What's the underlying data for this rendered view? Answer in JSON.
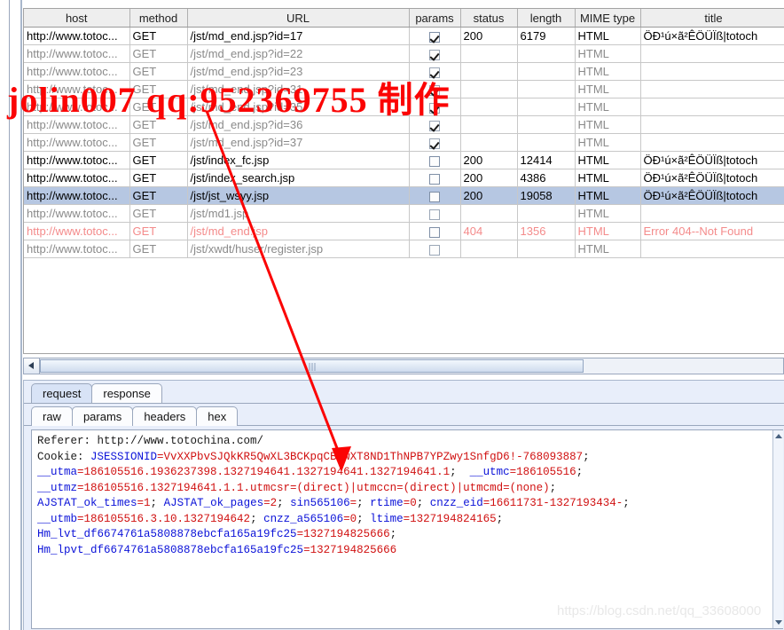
{
  "table": {
    "columns": [
      "host",
      "method",
      "URL",
      "params",
      "status",
      "length",
      "MIME type",
      "title"
    ],
    "rows": [
      {
        "host": "http://www.totoc...",
        "method": "GET",
        "url": "/jst/md_end.jsp?id=17",
        "params": true,
        "status": "200",
        "length": "6179",
        "mime": "HTML",
        "title": "ÖÐ¹ú×ã²ÊÖÜÏß|totoch",
        "style": "normal"
      },
      {
        "host": "http://www.totoc...",
        "method": "GET",
        "url": "/jst/md_end.jsp?id=22",
        "params": true,
        "status": "",
        "length": "",
        "mime": "HTML",
        "title": "",
        "style": "dim"
      },
      {
        "host": "http://www.totoc...",
        "method": "GET",
        "url": "/jst/md_end.jsp?id=23",
        "params": true,
        "status": "",
        "length": "",
        "mime": "HTML",
        "title": "",
        "style": "dim"
      },
      {
        "host": "http://www.totoc...",
        "method": "GET",
        "url": "/jst/md_end.jsp?id=31",
        "params": true,
        "status": "",
        "length": "",
        "mime": "HTML",
        "title": "",
        "style": "dim"
      },
      {
        "host": "http://www.totoc...",
        "method": "GET",
        "url": "/jst/md_end.jsp?id=35",
        "params": true,
        "status": "",
        "length": "",
        "mime": "HTML",
        "title": "",
        "style": "dim"
      },
      {
        "host": "http://www.totoc...",
        "method": "GET",
        "url": "/jst/md_end.jsp?id=36",
        "params": true,
        "status": "",
        "length": "",
        "mime": "HTML",
        "title": "",
        "style": "dim"
      },
      {
        "host": "http://www.totoc...",
        "method": "GET",
        "url": "/jst/md_end.jsp?id=37",
        "params": true,
        "status": "",
        "length": "",
        "mime": "HTML",
        "title": "",
        "style": "dim"
      },
      {
        "host": "http://www.totoc...",
        "method": "GET",
        "url": "/jst/index_fc.jsp",
        "params": false,
        "status": "200",
        "length": "12414",
        "mime": "HTML",
        "title": "ÖÐ¹ú×ã²ÊÖÜÏß|totoch",
        "style": "normal"
      },
      {
        "host": "http://www.totoc...",
        "method": "GET",
        "url": "/jst/index_search.jsp",
        "params": false,
        "status": "200",
        "length": "4386",
        "mime": "HTML",
        "title": "ÖÐ¹ú×ã²ÊÖÜÏß|totoch",
        "style": "normal"
      },
      {
        "host": "http://www.totoc...",
        "method": "GET",
        "url": "/jst/jst_wsyy.jsp",
        "params": false,
        "status": "200",
        "length": "19058",
        "mime": "HTML",
        "title": "ÖÐ¹ú×ã²ÊÖÜÏß|totoch",
        "style": "selected"
      },
      {
        "host": "http://www.totoc...",
        "method": "GET",
        "url": "/jst/md1.jsp",
        "params": false,
        "status": "",
        "length": "",
        "mime": "HTML",
        "title": "",
        "style": "dim"
      },
      {
        "host": "http://www.totoc...",
        "method": "GET",
        "url": "/jst/md_end.jsp",
        "params": false,
        "status": "404",
        "length": "1356",
        "mime": "HTML",
        "title": "Error 404--Not Found",
        "style": "error"
      },
      {
        "host": "http://www.totoc...",
        "method": "GET",
        "url": "/jst/xwdt/huser/register.jsp",
        "params": false,
        "status": "",
        "length": "",
        "mime": "HTML",
        "title": "",
        "style": "dim"
      }
    ]
  },
  "bottom": {
    "main_tabs": [
      {
        "label": "request",
        "active": true
      },
      {
        "label": "response",
        "active": false
      }
    ],
    "sub_tabs": [
      {
        "label": "raw",
        "active": true
      },
      {
        "label": "params",
        "active": false
      },
      {
        "label": "headers",
        "active": false
      },
      {
        "label": "hex",
        "active": false
      }
    ]
  },
  "request_body": {
    "lines": [
      [
        {
          "t": "Referer: http://www.totochina.com/",
          "c": "plain"
        }
      ],
      [
        {
          "t": "Cookie: ",
          "c": "plain"
        },
        {
          "t": "JSESSIONID",
          "c": "key"
        },
        {
          "t": "=VvXXPbvSJQkKR5QwXL3BCKpqCBJwXT8ND1ThNPB7YPZwy1SnfgD6!-768093887",
          "c": "val"
        },
        {
          "t": ";",
          "c": "plain"
        }
      ],
      [
        {
          "t": "__utma",
          "c": "key"
        },
        {
          "t": "=186105516.1936237398.1327194641.1327194641.1327194641.1",
          "c": "val"
        },
        {
          "t": ";  ",
          "c": "plain"
        },
        {
          "t": "__utmc",
          "c": "key"
        },
        {
          "t": "=186105516",
          "c": "val"
        },
        {
          "t": ";",
          "c": "plain"
        }
      ],
      [
        {
          "t": "__utmz",
          "c": "key"
        },
        {
          "t": "=186105516.1327194641.1.1.utmcsr=(direct)|utmccn=(direct)|utmcmd=(none)",
          "c": "val"
        },
        {
          "t": ";",
          "c": "plain"
        }
      ],
      [
        {
          "t": "AJSTAT_ok_times",
          "c": "key"
        },
        {
          "t": "=1",
          "c": "val"
        },
        {
          "t": "; ",
          "c": "plain"
        },
        {
          "t": "AJSTAT_ok_pages",
          "c": "key"
        },
        {
          "t": "=2",
          "c": "val"
        },
        {
          "t": "; ",
          "c": "plain"
        },
        {
          "t": "sin565106",
          "c": "key"
        },
        {
          "t": "=",
          "c": "val"
        },
        {
          "t": "; ",
          "c": "plain"
        },
        {
          "t": "rtime",
          "c": "key"
        },
        {
          "t": "=0",
          "c": "val"
        },
        {
          "t": "; ",
          "c": "plain"
        },
        {
          "t": "cnzz_eid",
          "c": "key"
        },
        {
          "t": "=16611731-1327193434-",
          "c": "val"
        },
        {
          "t": ";",
          "c": "plain"
        }
      ],
      [
        {
          "t": "__utmb",
          "c": "key"
        },
        {
          "t": "=186105516.3.10.1327194642",
          "c": "val"
        },
        {
          "t": "; ",
          "c": "plain"
        },
        {
          "t": "cnzz_a565106",
          "c": "key"
        },
        {
          "t": "=0",
          "c": "val"
        },
        {
          "t": "; ",
          "c": "plain"
        },
        {
          "t": "ltime",
          "c": "key"
        },
        {
          "t": "=1327194824165",
          "c": "val"
        },
        {
          "t": ";",
          "c": "plain"
        }
      ],
      [
        {
          "t": "Hm_lvt_df6674761a5808878ebcfa165a19fc25",
          "c": "key"
        },
        {
          "t": "=1327194825666",
          "c": "val"
        },
        {
          "t": ";",
          "c": "plain"
        }
      ],
      [
        {
          "t": "Hm_lpvt_df6674761a5808878ebcfa165a19fc25",
          "c": "key"
        },
        {
          "t": "=1327194825666",
          "c": "val"
        }
      ]
    ]
  },
  "watermarks": {
    "red_text": "jolin007  qq:952369755  制作",
    "csdn_text": "https://blog.csdn.net/qq_33608000"
  },
  "colors": {
    "watermark_red": "#fb0404",
    "selection_blue": "#b6c7e2",
    "error_pink": "#f48b8b",
    "cookie_key": "#0b12d8",
    "cookie_value": "#d01010"
  }
}
